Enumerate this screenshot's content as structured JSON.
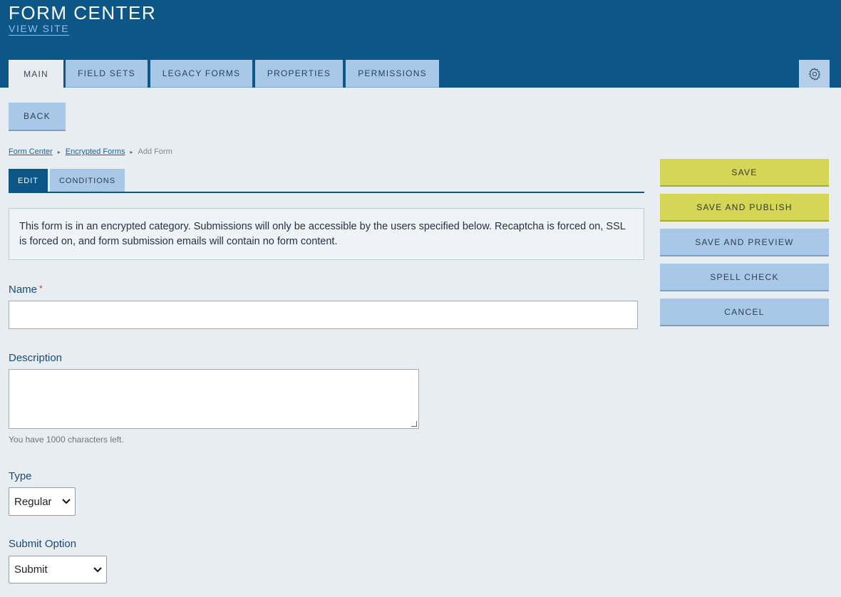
{
  "header": {
    "title": "FORM CENTER",
    "view_site": "VIEW SITE"
  },
  "main_tabs": [
    {
      "label": "MAIN",
      "active": true
    },
    {
      "label": "FIELD SETS",
      "active": false
    },
    {
      "label": "LEGACY FORMS",
      "active": false
    },
    {
      "label": "PROPERTIES",
      "active": false
    },
    {
      "label": "PERMISSIONS",
      "active": false
    }
  ],
  "settings_icon": "gear-icon",
  "back_label": "BACK",
  "breadcrumb": {
    "items": [
      "Form Center",
      "Encrypted Forms"
    ],
    "current": "Add Form",
    "separator": "▸"
  },
  "sub_tabs": [
    {
      "label": "EDIT",
      "active": true
    },
    {
      "label": "CONDITIONS",
      "active": false
    }
  ],
  "notice": "This form is in an encrypted category. Submissions will only be accessible by the users specified below. Recaptcha is forced on, SSL is forced on, and form submission emails will contain no form content.",
  "form": {
    "name_label": "Name",
    "required_marker": "*",
    "name_value": "",
    "description_label": "Description",
    "description_value": "",
    "char_count": "You have 1000 characters left.",
    "type_label": "Type",
    "type_value": "Regular",
    "submit_option_label": "Submit Option",
    "submit_option_value": "Submit"
  },
  "actions": {
    "save": "SAVE",
    "save_publish": "SAVE AND PUBLISH",
    "save_preview": "SAVE AND PREVIEW",
    "spell_check": "SPELL CHECK",
    "cancel": "CANCEL"
  },
  "colors": {
    "header": "#0c5688",
    "tab": "#a9c7e6",
    "primary_action": "#d5d556",
    "background": "#e8edf2"
  }
}
